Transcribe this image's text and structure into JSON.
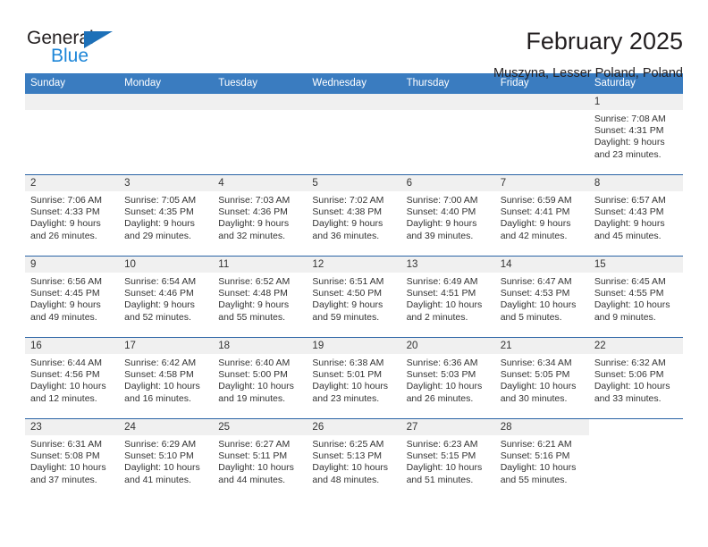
{
  "brand": {
    "name_part1": "General",
    "name_part2": "Blue",
    "triangle_color": "#1d70b8",
    "blue_color": "#1d86d8"
  },
  "header": {
    "month_title": "February 2025",
    "location": "Muszyna, Lesser Poland, Poland"
  },
  "theme": {
    "header_bg": "#3a7cc0",
    "row_divider": "#2a63a5",
    "daynum_band": "#f0f0f0"
  },
  "weekday_headers": [
    "Sunday",
    "Monday",
    "Tuesday",
    "Wednesday",
    "Thursday",
    "Friday",
    "Saturday"
  ],
  "weeks": [
    [
      {
        "day": "",
        "sunrise": "",
        "sunset": "",
        "daylight_line1": "",
        "daylight_line2": "",
        "state": "empty"
      },
      {
        "day": "",
        "sunrise": "",
        "sunset": "",
        "daylight_line1": "",
        "daylight_line2": "",
        "state": "empty"
      },
      {
        "day": "",
        "sunrise": "",
        "sunset": "",
        "daylight_line1": "",
        "daylight_line2": "",
        "state": "empty"
      },
      {
        "day": "",
        "sunrise": "",
        "sunset": "",
        "daylight_line1": "",
        "daylight_line2": "",
        "state": "empty"
      },
      {
        "day": "",
        "sunrise": "",
        "sunset": "",
        "daylight_line1": "",
        "daylight_line2": "",
        "state": "empty"
      },
      {
        "day": "",
        "sunrise": "",
        "sunset": "",
        "daylight_line1": "",
        "daylight_line2": "",
        "state": "empty"
      },
      {
        "day": "1",
        "sunrise": "Sunrise: 7:08 AM",
        "sunset": "Sunset: 4:31 PM",
        "daylight_line1": "Daylight: 9 hours",
        "daylight_line2": "and 23 minutes.",
        "state": "filled"
      }
    ],
    [
      {
        "day": "2",
        "sunrise": "Sunrise: 7:06 AM",
        "sunset": "Sunset: 4:33 PM",
        "daylight_line1": "Daylight: 9 hours",
        "daylight_line2": "and 26 minutes.",
        "state": "filled"
      },
      {
        "day": "3",
        "sunrise": "Sunrise: 7:05 AM",
        "sunset": "Sunset: 4:35 PM",
        "daylight_line1": "Daylight: 9 hours",
        "daylight_line2": "and 29 minutes.",
        "state": "filled"
      },
      {
        "day": "4",
        "sunrise": "Sunrise: 7:03 AM",
        "sunset": "Sunset: 4:36 PM",
        "daylight_line1": "Daylight: 9 hours",
        "daylight_line2": "and 32 minutes.",
        "state": "filled"
      },
      {
        "day": "5",
        "sunrise": "Sunrise: 7:02 AM",
        "sunset": "Sunset: 4:38 PM",
        "daylight_line1": "Daylight: 9 hours",
        "daylight_line2": "and 36 minutes.",
        "state": "filled"
      },
      {
        "day": "6",
        "sunrise": "Sunrise: 7:00 AM",
        "sunset": "Sunset: 4:40 PM",
        "daylight_line1": "Daylight: 9 hours",
        "daylight_line2": "and 39 minutes.",
        "state": "filled"
      },
      {
        "day": "7",
        "sunrise": "Sunrise: 6:59 AM",
        "sunset": "Sunset: 4:41 PM",
        "daylight_line1": "Daylight: 9 hours",
        "daylight_line2": "and 42 minutes.",
        "state": "filled"
      },
      {
        "day": "8",
        "sunrise": "Sunrise: 6:57 AM",
        "sunset": "Sunset: 4:43 PM",
        "daylight_line1": "Daylight: 9 hours",
        "daylight_line2": "and 45 minutes.",
        "state": "filled"
      }
    ],
    [
      {
        "day": "9",
        "sunrise": "Sunrise: 6:56 AM",
        "sunset": "Sunset: 4:45 PM",
        "daylight_line1": "Daylight: 9 hours",
        "daylight_line2": "and 49 minutes.",
        "state": "filled"
      },
      {
        "day": "10",
        "sunrise": "Sunrise: 6:54 AM",
        "sunset": "Sunset: 4:46 PM",
        "daylight_line1": "Daylight: 9 hours",
        "daylight_line2": "and 52 minutes.",
        "state": "filled"
      },
      {
        "day": "11",
        "sunrise": "Sunrise: 6:52 AM",
        "sunset": "Sunset: 4:48 PM",
        "daylight_line1": "Daylight: 9 hours",
        "daylight_line2": "and 55 minutes.",
        "state": "filled"
      },
      {
        "day": "12",
        "sunrise": "Sunrise: 6:51 AM",
        "sunset": "Sunset: 4:50 PM",
        "daylight_line1": "Daylight: 9 hours",
        "daylight_line2": "and 59 minutes.",
        "state": "filled"
      },
      {
        "day": "13",
        "sunrise": "Sunrise: 6:49 AM",
        "sunset": "Sunset: 4:51 PM",
        "daylight_line1": "Daylight: 10 hours",
        "daylight_line2": "and 2 minutes.",
        "state": "filled"
      },
      {
        "day": "14",
        "sunrise": "Sunrise: 6:47 AM",
        "sunset": "Sunset: 4:53 PM",
        "daylight_line1": "Daylight: 10 hours",
        "daylight_line2": "and 5 minutes.",
        "state": "filled"
      },
      {
        "day": "15",
        "sunrise": "Sunrise: 6:45 AM",
        "sunset": "Sunset: 4:55 PM",
        "daylight_line1": "Daylight: 10 hours",
        "daylight_line2": "and 9 minutes.",
        "state": "filled"
      }
    ],
    [
      {
        "day": "16",
        "sunrise": "Sunrise: 6:44 AM",
        "sunset": "Sunset: 4:56 PM",
        "daylight_line1": "Daylight: 10 hours",
        "daylight_line2": "and 12 minutes.",
        "state": "filled"
      },
      {
        "day": "17",
        "sunrise": "Sunrise: 6:42 AM",
        "sunset": "Sunset: 4:58 PM",
        "daylight_line1": "Daylight: 10 hours",
        "daylight_line2": "and 16 minutes.",
        "state": "filled"
      },
      {
        "day": "18",
        "sunrise": "Sunrise: 6:40 AM",
        "sunset": "Sunset: 5:00 PM",
        "daylight_line1": "Daylight: 10 hours",
        "daylight_line2": "and 19 minutes.",
        "state": "filled"
      },
      {
        "day": "19",
        "sunrise": "Sunrise: 6:38 AM",
        "sunset": "Sunset: 5:01 PM",
        "daylight_line1": "Daylight: 10 hours",
        "daylight_line2": "and 23 minutes.",
        "state": "filled"
      },
      {
        "day": "20",
        "sunrise": "Sunrise: 6:36 AM",
        "sunset": "Sunset: 5:03 PM",
        "daylight_line1": "Daylight: 10 hours",
        "daylight_line2": "and 26 minutes.",
        "state": "filled"
      },
      {
        "day": "21",
        "sunrise": "Sunrise: 6:34 AM",
        "sunset": "Sunset: 5:05 PM",
        "daylight_line1": "Daylight: 10 hours",
        "daylight_line2": "and 30 minutes.",
        "state": "filled"
      },
      {
        "day": "22",
        "sunrise": "Sunrise: 6:32 AM",
        "sunset": "Sunset: 5:06 PM",
        "daylight_line1": "Daylight: 10 hours",
        "daylight_line2": "and 33 minutes.",
        "state": "filled"
      }
    ],
    [
      {
        "day": "23",
        "sunrise": "Sunrise: 6:31 AM",
        "sunset": "Sunset: 5:08 PM",
        "daylight_line1": "Daylight: 10 hours",
        "daylight_line2": "and 37 minutes.",
        "state": "filled"
      },
      {
        "day": "24",
        "sunrise": "Sunrise: 6:29 AM",
        "sunset": "Sunset: 5:10 PM",
        "daylight_line1": "Daylight: 10 hours",
        "daylight_line2": "and 41 minutes.",
        "state": "filled"
      },
      {
        "day": "25",
        "sunrise": "Sunrise: 6:27 AM",
        "sunset": "Sunset: 5:11 PM",
        "daylight_line1": "Daylight: 10 hours",
        "daylight_line2": "and 44 minutes.",
        "state": "filled"
      },
      {
        "day": "26",
        "sunrise": "Sunrise: 6:25 AM",
        "sunset": "Sunset: 5:13 PM",
        "daylight_line1": "Daylight: 10 hours",
        "daylight_line2": "and 48 minutes.",
        "state": "filled"
      },
      {
        "day": "27",
        "sunrise": "Sunrise: 6:23 AM",
        "sunset": "Sunset: 5:15 PM",
        "daylight_line1": "Daylight: 10 hours",
        "daylight_line2": "and 51 minutes.",
        "state": "filled"
      },
      {
        "day": "28",
        "sunrise": "Sunrise: 6:21 AM",
        "sunset": "Sunset: 5:16 PM",
        "daylight_line1": "Daylight: 10 hours",
        "daylight_line2": "and 55 minutes.",
        "state": "filled"
      },
      {
        "day": "",
        "sunrise": "",
        "sunset": "",
        "daylight_line1": "",
        "daylight_line2": "",
        "state": "blank"
      }
    ]
  ]
}
